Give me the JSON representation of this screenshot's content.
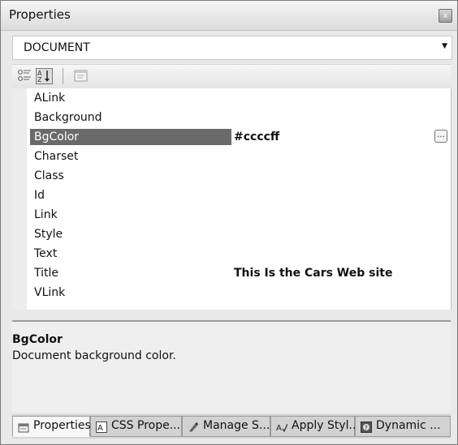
{
  "window": {
    "title": "Properties",
    "close_symbol": "x"
  },
  "object_selector": {
    "value": "DOCUMENT",
    "arrow": "▼"
  },
  "toolbar": [
    {
      "name": "categorized-icon",
      "label": "Categorized"
    },
    {
      "name": "alphabetical-icon",
      "label": "Alphabetical",
      "pressed": true
    },
    {
      "name": "events-icon",
      "label": "Events"
    }
  ],
  "properties": [
    {
      "name": "ALink",
      "value": ""
    },
    {
      "name": "Background",
      "value": ""
    },
    {
      "name": "BgColor",
      "value": "#ccccff",
      "selected": true,
      "has_button": true
    },
    {
      "name": "Charset",
      "value": ""
    },
    {
      "name": "Class",
      "value": ""
    },
    {
      "name": "Id",
      "value": ""
    },
    {
      "name": "Link",
      "value": ""
    },
    {
      "name": "Style",
      "value": ""
    },
    {
      "name": "Text",
      "value": ""
    },
    {
      "name": "Title",
      "value": "This Is the Cars Web site"
    },
    {
      "name": "VLink",
      "value": ""
    }
  ],
  "ellipsis_label": "...",
  "description": {
    "title": "BgColor",
    "text": "Document background color."
  },
  "tabs": [
    {
      "label": "Properties",
      "icon": "properties-icon",
      "active": true
    },
    {
      "label": "CSS Prope...",
      "icon": "css-properties-icon"
    },
    {
      "label": "Manage S...",
      "icon": "manage-styles-icon"
    },
    {
      "label": "Apply Styl..",
      "icon": "apply-styles-icon"
    },
    {
      "label": "Dynamic ...",
      "icon": "dynamic-help-icon"
    }
  ]
}
